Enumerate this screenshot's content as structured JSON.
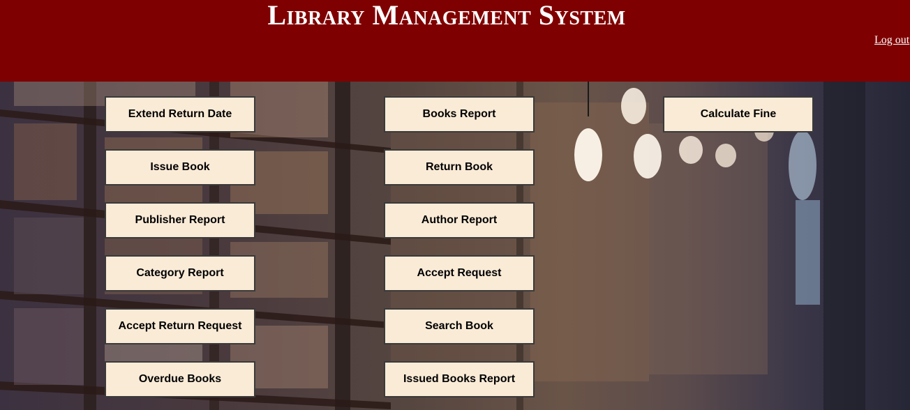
{
  "header": {
    "title": "Library Management System",
    "logout_label": "Log out",
    "background_color": "#7f0000"
  },
  "buttons": {
    "extend_return_date": "Extend Return Date",
    "books_report": "Books Report",
    "calculate_fine": "Calculate Fine",
    "issue_book": "Issue Book",
    "return_book": "Return Book",
    "publisher_report": "Publisher Report",
    "author_report": "Author Report",
    "category_report": "Category Report",
    "accept_request": "Accept Request",
    "accept_return_request": "Accept Return Request",
    "search_book": "Search Book",
    "overdue_books": "Overdue Books",
    "issued_books_report": "Issued Books Report"
  },
  "styles": {
    "button_background": "#faebd7",
    "button_border": "#3a3a3a"
  }
}
